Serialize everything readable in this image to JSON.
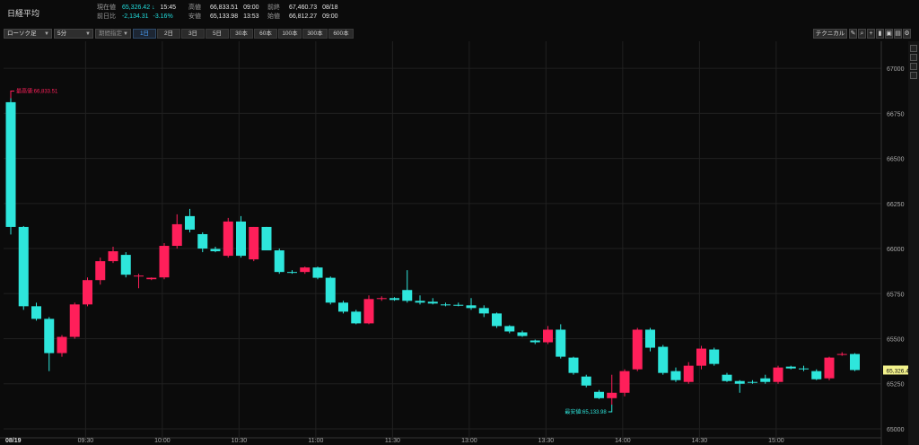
{
  "header": {
    "title": "日経平均",
    "current_label": "現在値",
    "current_value": "65,326.42",
    "current_arrow": "↓",
    "current_time": "15:45",
    "change_label": "前日比",
    "change_value": "-2,134.31",
    "change_pct": "-3.16%",
    "high_label": "高値",
    "high_value": "66,833.51",
    "high_time": "09:00",
    "low_label": "安値",
    "low_value": "65,133.98",
    "low_time": "13:53",
    "prev_label": "前終",
    "prev_value": "67,460.73",
    "prev_date": "08/18",
    "open_label": "始値",
    "open_value": "66,812.27",
    "open_time": "09:00"
  },
  "toolbar": {
    "chart_type": "ローソク足",
    "interval": "5分",
    "period_placeholder": "期間指定",
    "periods": [
      "1日",
      "2日",
      "3日",
      "5日",
      "30本",
      "60本",
      "100本",
      "300本",
      "600本"
    ],
    "technical": "テクニカル"
  },
  "colors": {
    "up": "#ff1f5a",
    "down": "#2ee6dc",
    "grid": "#202020",
    "last_price_bg": "#f3f28c"
  },
  "chart_data": {
    "type": "candlestick",
    "date_label": "08/19",
    "ylim": [
      64950,
      67150
    ],
    "y_ticks": [
      65000,
      65250,
      65500,
      65750,
      66000,
      66250,
      66500,
      66750,
      67000
    ],
    "x_ticks": [
      "09:30",
      "10:00",
      "10:30",
      "11:00",
      "11:30",
      "13:00",
      "13:30",
      "14:00",
      "14:30",
      "15:00"
    ],
    "high_label": "最高値:66,833.51",
    "low_label": "最安値:65,133.98",
    "last_price": "65,326.42",
    "candles": [
      [
        66812,
        66834,
        66078,
        66120
      ],
      [
        66120,
        66125,
        65660,
        65680
      ],
      [
        65680,
        65700,
        65600,
        65610
      ],
      [
        65610,
        65620,
        65320,
        65420
      ],
      [
        65420,
        65520,
        65400,
        65510
      ],
      [
        65510,
        65700,
        65500,
        65690
      ],
      [
        65690,
        65840,
        65680,
        65825
      ],
      [
        65825,
        65950,
        65800,
        65930
      ],
      [
        65930,
        66010,
        65920,
        65985
      ],
      [
        65965,
        65980,
        65840,
        65855
      ],
      [
        65845,
        65860,
        65780,
        65850
      ],
      [
        65830,
        65840,
        65825,
        65838
      ],
      [
        65840,
        66030,
        65830,
        66015
      ],
      [
        66015,
        66190,
        66000,
        66135
      ],
      [
        66180,
        66220,
        66090,
        66105
      ],
      [
        66080,
        66090,
        65980,
        66000
      ],
      [
        65998,
        66010,
        65980,
        65985
      ],
      [
        65960,
        66170,
        65950,
        66150
      ],
      [
        66150,
        66180,
        65950,
        65960
      ],
      [
        65940,
        66120,
        65930,
        66120
      ],
      [
        66120,
        66120,
        65990,
        65990
      ],
      [
        65990,
        66000,
        65860,
        65870
      ],
      [
        65870,
        65880,
        65860,
        65865
      ],
      [
        65870,
        65900,
        65860,
        65895
      ],
      [
        65895,
        65900,
        65830,
        65838
      ],
      [
        65838,
        65845,
        65690,
        65700
      ],
      [
        65700,
        65710,
        65640,
        65650
      ],
      [
        65650,
        65660,
        65580,
        65585
      ],
      [
        65585,
        65740,
        65580,
        65720
      ],
      [
        65720,
        65735,
        65710,
        65725
      ],
      [
        65725,
        65730,
        65710,
        65715
      ],
      [
        65770,
        65880,
        65700,
        65710
      ],
      [
        65710,
        65740,
        65690,
        65700
      ],
      [
        65705,
        65725,
        65690,
        65695
      ],
      [
        65690,
        65700,
        65680,
        65688
      ],
      [
        65688,
        65700,
        65680,
        65685
      ],
      [
        65685,
        65725,
        65660,
        65670
      ],
      [
        65670,
        65685,
        65620,
        65640
      ],
      [
        65640,
        65645,
        65560,
        65570
      ],
      [
        65570,
        65575,
        65530,
        65540
      ],
      [
        65535,
        65545,
        65510,
        65515
      ],
      [
        65490,
        65495,
        65470,
        65480
      ],
      [
        65480,
        65570,
        65470,
        65550
      ],
      [
        65550,
        65580,
        65390,
        65400
      ],
      [
        65395,
        65400,
        65300,
        65310
      ],
      [
        65290,
        65300,
        65230,
        65240
      ],
      [
        65205,
        65215,
        65165,
        65170
      ],
      [
        65170,
        65300,
        65134,
        65200
      ],
      [
        65200,
        65330,
        65180,
        65320
      ],
      [
        65330,
        65560,
        65320,
        65550
      ],
      [
        65550,
        65560,
        65430,
        65450
      ],
      [
        65455,
        65465,
        65300,
        65310
      ],
      [
        65320,
        65340,
        65260,
        65270
      ],
      [
        65260,
        65370,
        65250,
        65350
      ],
      [
        65350,
        65460,
        65330,
        65445
      ],
      [
        65440,
        65450,
        65350,
        65360
      ],
      [
        65300,
        65310,
        65260,
        65265
      ],
      [
        65265,
        65270,
        65200,
        65250
      ],
      [
        65260,
        65270,
        65250,
        65255
      ],
      [
        65280,
        65300,
        65250,
        65260
      ],
      [
        65260,
        65350,
        65250,
        65340
      ],
      [
        65345,
        65350,
        65330,
        65335
      ],
      [
        65335,
        65350,
        65320,
        65330
      ],
      [
        65320,
        65330,
        65270,
        65275
      ],
      [
        65280,
        65400,
        65270,
        65395
      ],
      [
        65410,
        65425,
        65405,
        65415
      ],
      [
        65415,
        65420,
        65320,
        65326
      ]
    ]
  }
}
